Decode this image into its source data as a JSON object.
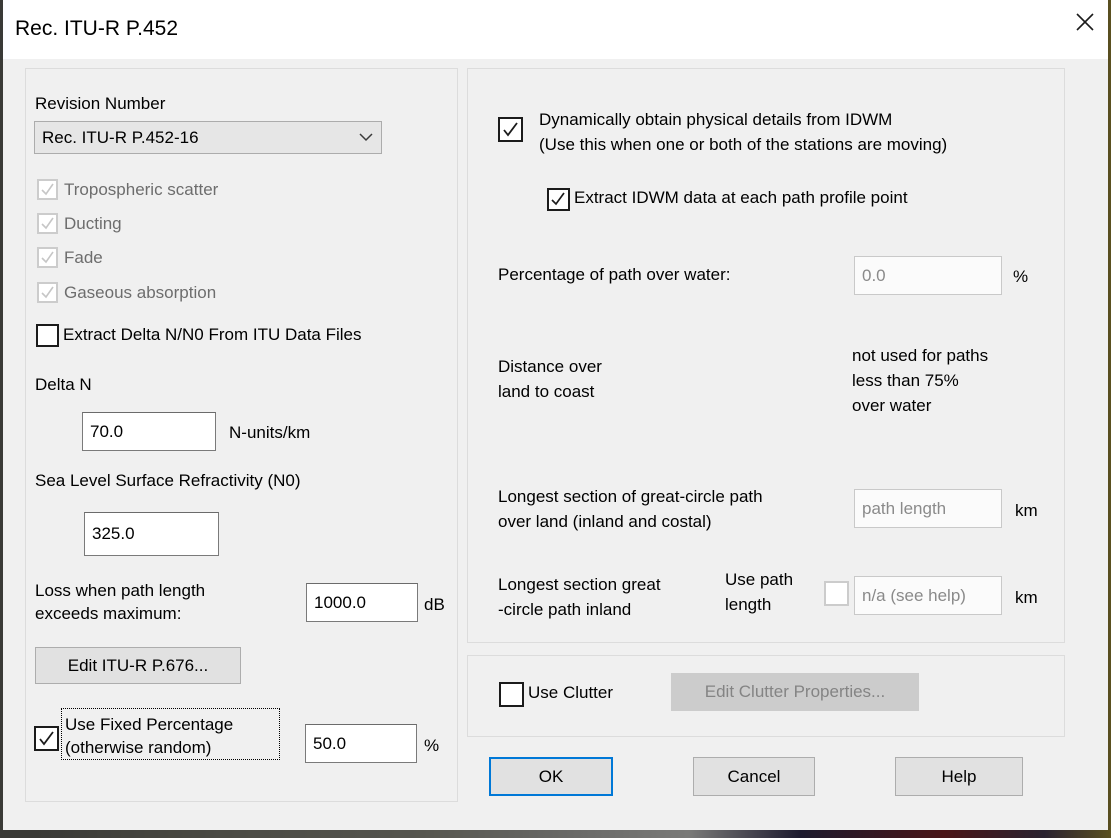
{
  "window": {
    "title": "Rec. ITU-R P.452",
    "close_icon": "close-icon"
  },
  "left_panel": {
    "revision_label": "Revision Number",
    "revision_value": "Rec. ITU-R P.452-16",
    "dropdown_icon": "chevron-down-icon",
    "mode_checks": [
      {
        "label": "Tropospheric scatter",
        "checked": true,
        "enabled": false
      },
      {
        "label": "Ducting",
        "checked": true,
        "enabled": false
      },
      {
        "label": "Fade",
        "checked": true,
        "enabled": false
      },
      {
        "label": "Gaseous absorption",
        "checked": true,
        "enabled": false
      }
    ],
    "extract_delta_label": "Extract Delta N/N0 From ITU Data Files",
    "extract_delta_checked": false,
    "delta_n_label": "Delta N",
    "delta_n_value": "70.0",
    "delta_n_units": "N-units/km",
    "n0_label": "Sea Level Surface Refractivity (N0)",
    "n0_value": "325.0",
    "loss_label_line1": "Loss when path length",
    "loss_label_line2": "exceeds maximum:",
    "loss_value": "1000.0",
    "loss_units": "dB",
    "edit_676_label": "Edit ITU-R P.676...",
    "fixed_pct_label_line1": "Use Fixed Percentage",
    "fixed_pct_label_line2": "(otherwise random)",
    "fixed_pct_checked": true,
    "fixed_pct_value": "50.0",
    "fixed_pct_units": "%"
  },
  "right_panel": {
    "idwm_label_line1": "Dynamically obtain physical details from IDWM",
    "idwm_label_line2": "(Use this when one or both of the stations are moving)",
    "idwm_checked": true,
    "extract_idwm_label": "Extract IDWM data at each path profile point",
    "extract_idwm_checked": true,
    "pct_water_label": "Percentage of path over water:",
    "pct_water_value": "0.0",
    "pct_water_units": "%",
    "distance_label_line1": "Distance over",
    "distance_label_line2": "land to coast",
    "note_line1": "not used for paths",
    "note_line2": "less than 75%",
    "note_line3": "over water",
    "longest_land_line1": "Longest section of great-circle path",
    "longest_land_line2": "over land (inland and costal)",
    "longest_land_value": "path length",
    "longest_land_units": "km",
    "longest_inland_line1": "Longest section great",
    "longest_inland_line2": "-circle path inland",
    "use_path_length_line1": "Use path",
    "use_path_length_line2": "length",
    "use_path_length_checked": false,
    "longest_inland_value": "n/a (see help)",
    "longest_inland_units": "km"
  },
  "clutter_panel": {
    "use_clutter_label": "Use Clutter",
    "use_clutter_checked": false,
    "edit_clutter_label": "Edit Clutter Properties..."
  },
  "buttons": {
    "ok": "OK",
    "cancel": "Cancel",
    "help": "Help"
  },
  "colors": {
    "accent": "#0078d7",
    "window_bg": "#f0f0f0",
    "titlebar_bg": "#ffffff",
    "disabled_text": "#8a8a8a"
  }
}
